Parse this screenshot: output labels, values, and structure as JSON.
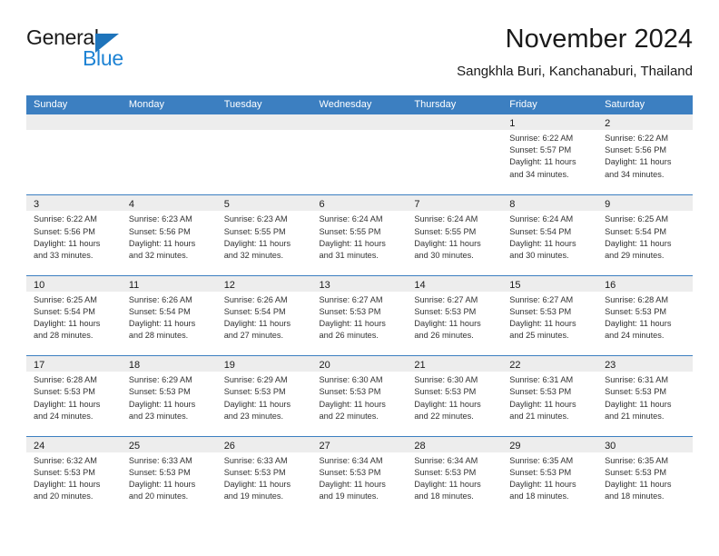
{
  "logo": {
    "word1": "General",
    "word2": "Blue",
    "triangle_color": "#1e74bb",
    "blue_color": "#1e83d4"
  },
  "header": {
    "title": "November 2024",
    "subtitle": "Sangkhla Buri, Kanchanaburi, Thailand"
  },
  "theme": {
    "header_blue": "#3c7fc1",
    "day_bar_gray": "#ededed",
    "text": "#1a1a1a"
  },
  "calendar": {
    "day_headers": [
      "Sunday",
      "Monday",
      "Tuesday",
      "Wednesday",
      "Thursday",
      "Friday",
      "Saturday"
    ],
    "weeks": [
      [
        {
          "day": "",
          "lines": []
        },
        {
          "day": "",
          "lines": []
        },
        {
          "day": "",
          "lines": []
        },
        {
          "day": "",
          "lines": []
        },
        {
          "day": "",
          "lines": []
        },
        {
          "day": "1",
          "lines": [
            "Sunrise: 6:22 AM",
            "Sunset: 5:57 PM",
            "Daylight: 11 hours",
            "and 34 minutes."
          ]
        },
        {
          "day": "2",
          "lines": [
            "Sunrise: 6:22 AM",
            "Sunset: 5:56 PM",
            "Daylight: 11 hours",
            "and 34 minutes."
          ]
        }
      ],
      [
        {
          "day": "3",
          "lines": [
            "Sunrise: 6:22 AM",
            "Sunset: 5:56 PM",
            "Daylight: 11 hours",
            "and 33 minutes."
          ]
        },
        {
          "day": "4",
          "lines": [
            "Sunrise: 6:23 AM",
            "Sunset: 5:56 PM",
            "Daylight: 11 hours",
            "and 32 minutes."
          ]
        },
        {
          "day": "5",
          "lines": [
            "Sunrise: 6:23 AM",
            "Sunset: 5:55 PM",
            "Daylight: 11 hours",
            "and 32 minutes."
          ]
        },
        {
          "day": "6",
          "lines": [
            "Sunrise: 6:24 AM",
            "Sunset: 5:55 PM",
            "Daylight: 11 hours",
            "and 31 minutes."
          ]
        },
        {
          "day": "7",
          "lines": [
            "Sunrise: 6:24 AM",
            "Sunset: 5:55 PM",
            "Daylight: 11 hours",
            "and 30 minutes."
          ]
        },
        {
          "day": "8",
          "lines": [
            "Sunrise: 6:24 AM",
            "Sunset: 5:54 PM",
            "Daylight: 11 hours",
            "and 30 minutes."
          ]
        },
        {
          "day": "9",
          "lines": [
            "Sunrise: 6:25 AM",
            "Sunset: 5:54 PM",
            "Daylight: 11 hours",
            "and 29 minutes."
          ]
        }
      ],
      [
        {
          "day": "10",
          "lines": [
            "Sunrise: 6:25 AM",
            "Sunset: 5:54 PM",
            "Daylight: 11 hours",
            "and 28 minutes."
          ]
        },
        {
          "day": "11",
          "lines": [
            "Sunrise: 6:26 AM",
            "Sunset: 5:54 PM",
            "Daylight: 11 hours",
            "and 28 minutes."
          ]
        },
        {
          "day": "12",
          "lines": [
            "Sunrise: 6:26 AM",
            "Sunset: 5:54 PM",
            "Daylight: 11 hours",
            "and 27 minutes."
          ]
        },
        {
          "day": "13",
          "lines": [
            "Sunrise: 6:27 AM",
            "Sunset: 5:53 PM",
            "Daylight: 11 hours",
            "and 26 minutes."
          ]
        },
        {
          "day": "14",
          "lines": [
            "Sunrise: 6:27 AM",
            "Sunset: 5:53 PM",
            "Daylight: 11 hours",
            "and 26 minutes."
          ]
        },
        {
          "day": "15",
          "lines": [
            "Sunrise: 6:27 AM",
            "Sunset: 5:53 PM",
            "Daylight: 11 hours",
            "and 25 minutes."
          ]
        },
        {
          "day": "16",
          "lines": [
            "Sunrise: 6:28 AM",
            "Sunset: 5:53 PM",
            "Daylight: 11 hours",
            "and 24 minutes."
          ]
        }
      ],
      [
        {
          "day": "17",
          "lines": [
            "Sunrise: 6:28 AM",
            "Sunset: 5:53 PM",
            "Daylight: 11 hours",
            "and 24 minutes."
          ]
        },
        {
          "day": "18",
          "lines": [
            "Sunrise: 6:29 AM",
            "Sunset: 5:53 PM",
            "Daylight: 11 hours",
            "and 23 minutes."
          ]
        },
        {
          "day": "19",
          "lines": [
            "Sunrise: 6:29 AM",
            "Sunset: 5:53 PM",
            "Daylight: 11 hours",
            "and 23 minutes."
          ]
        },
        {
          "day": "20",
          "lines": [
            "Sunrise: 6:30 AM",
            "Sunset: 5:53 PM",
            "Daylight: 11 hours",
            "and 22 minutes."
          ]
        },
        {
          "day": "21",
          "lines": [
            "Sunrise: 6:30 AM",
            "Sunset: 5:53 PM",
            "Daylight: 11 hours",
            "and 22 minutes."
          ]
        },
        {
          "day": "22",
          "lines": [
            "Sunrise: 6:31 AM",
            "Sunset: 5:53 PM",
            "Daylight: 11 hours",
            "and 21 minutes."
          ]
        },
        {
          "day": "23",
          "lines": [
            "Sunrise: 6:31 AM",
            "Sunset: 5:53 PM",
            "Daylight: 11 hours",
            "and 21 minutes."
          ]
        }
      ],
      [
        {
          "day": "24",
          "lines": [
            "Sunrise: 6:32 AM",
            "Sunset: 5:53 PM",
            "Daylight: 11 hours",
            "and 20 minutes."
          ]
        },
        {
          "day": "25",
          "lines": [
            "Sunrise: 6:33 AM",
            "Sunset: 5:53 PM",
            "Daylight: 11 hours",
            "and 20 minutes."
          ]
        },
        {
          "day": "26",
          "lines": [
            "Sunrise: 6:33 AM",
            "Sunset: 5:53 PM",
            "Daylight: 11 hours",
            "and 19 minutes."
          ]
        },
        {
          "day": "27",
          "lines": [
            "Sunrise: 6:34 AM",
            "Sunset: 5:53 PM",
            "Daylight: 11 hours",
            "and 19 minutes."
          ]
        },
        {
          "day": "28",
          "lines": [
            "Sunrise: 6:34 AM",
            "Sunset: 5:53 PM",
            "Daylight: 11 hours",
            "and 18 minutes."
          ]
        },
        {
          "day": "29",
          "lines": [
            "Sunrise: 6:35 AM",
            "Sunset: 5:53 PM",
            "Daylight: 11 hours",
            "and 18 minutes."
          ]
        },
        {
          "day": "30",
          "lines": [
            "Sunrise: 6:35 AM",
            "Sunset: 5:53 PM",
            "Daylight: 11 hours",
            "and 18 minutes."
          ]
        }
      ]
    ]
  }
}
